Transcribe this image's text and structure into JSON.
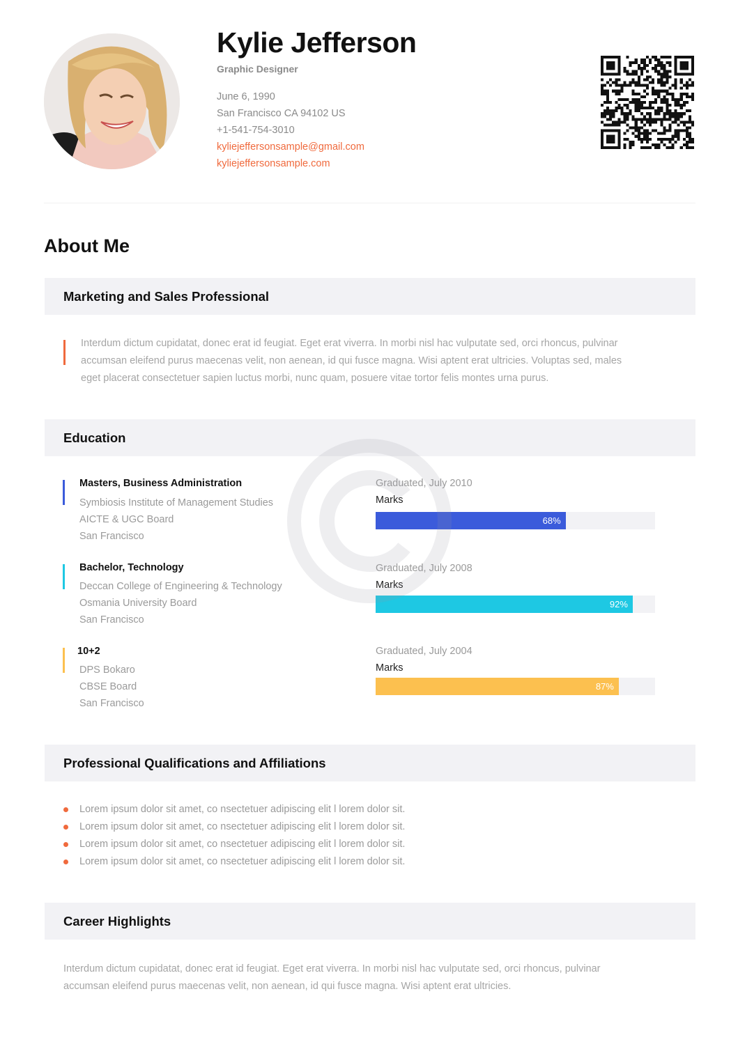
{
  "header": {
    "name": "Kylie Jefferson",
    "role": "Graphic Designer",
    "birthdate": "June 6, 1990",
    "address": "San Francisco CA 94102 US",
    "phone": "+1-541-754-3010",
    "email": "kyliejeffersonsample@gmail.com",
    "website": "kyliejeffersonsample.com"
  },
  "about": {
    "heading": "About Me",
    "subtitle": "Marketing and Sales Professional",
    "text_lines": [
      "Interdum dictum cupidatat, donec erat id feugiat. Eget erat viverra. In morbi nisl hac vulputate sed, orci rhoncus, pulvinar",
      "accumsan eleifend purus maecenas velit, non aenean, id qui fusce magna. Wisi aptent erat ultricies. Voluptas sed, males",
      "eget placerat consectetuer sapien luctus morbi, nunc quam, posuere vitae tortor felis montes urna purus."
    ]
  },
  "education": {
    "title": "Education",
    "marks_label": "Marks",
    "items": [
      {
        "degree": "Masters, Business Administration",
        "school": "Symbiosis  Institute of Management Studies",
        "board": "AICTE & UGC Board",
        "city": "San Francisco",
        "graduated": "Graduated, July 2010",
        "marks": 68,
        "marks_label": "68%",
        "color": "#3b5bdb"
      },
      {
        "degree": "Bachelor, Technology",
        "school": "Deccan College of Engineering & Technology",
        "board": "Osmania University Board",
        "city": "San Francisco",
        "graduated": "Graduated, July 2008",
        "marks": 92,
        "marks_label": "92%",
        "color": "#1ec8e3"
      },
      {
        "degree": "10+2",
        "school": "DPS Bokaro",
        "board": "CBSE Board",
        "city": "San Francisco",
        "graduated": "Graduated, July 2004",
        "marks": 87,
        "marks_label": "87%",
        "color": "#fcc04f"
      }
    ]
  },
  "qualifications": {
    "title": "Professional Qualifications and Affiliations",
    "items": [
      "Lorem ipsum dolor sit amet, co nsectetuer adipiscing elit l lorem dolor sit.",
      "Lorem ipsum dolor sit amet, co nsectetuer adipiscing elit l lorem dolor sit.",
      "Lorem ipsum dolor sit amet, co nsectetuer adipiscing elit l lorem dolor sit.",
      "Lorem ipsum dolor sit amet, co nsectetuer adipiscing elit l lorem dolor sit."
    ]
  },
  "career": {
    "title": "Career Highlights",
    "text_lines": [
      "Interdum dictum cupidatat, donec erat id feugiat. Eget erat viverra. In morbi nisl hac vulputate sed, orci rhoncus, pulvinar",
      "accumsan eleifend purus maecenas velit, non aenean, id qui fusce magna. Wisi aptent erat ultricies."
    ]
  },
  "colors": {
    "accent": "#f06a3d",
    "section_bg": "#f2f2f5"
  },
  "icons": {
    "watermark": "copyright-icon",
    "qr": "qr-code-icon",
    "photo": "profile-photo"
  }
}
